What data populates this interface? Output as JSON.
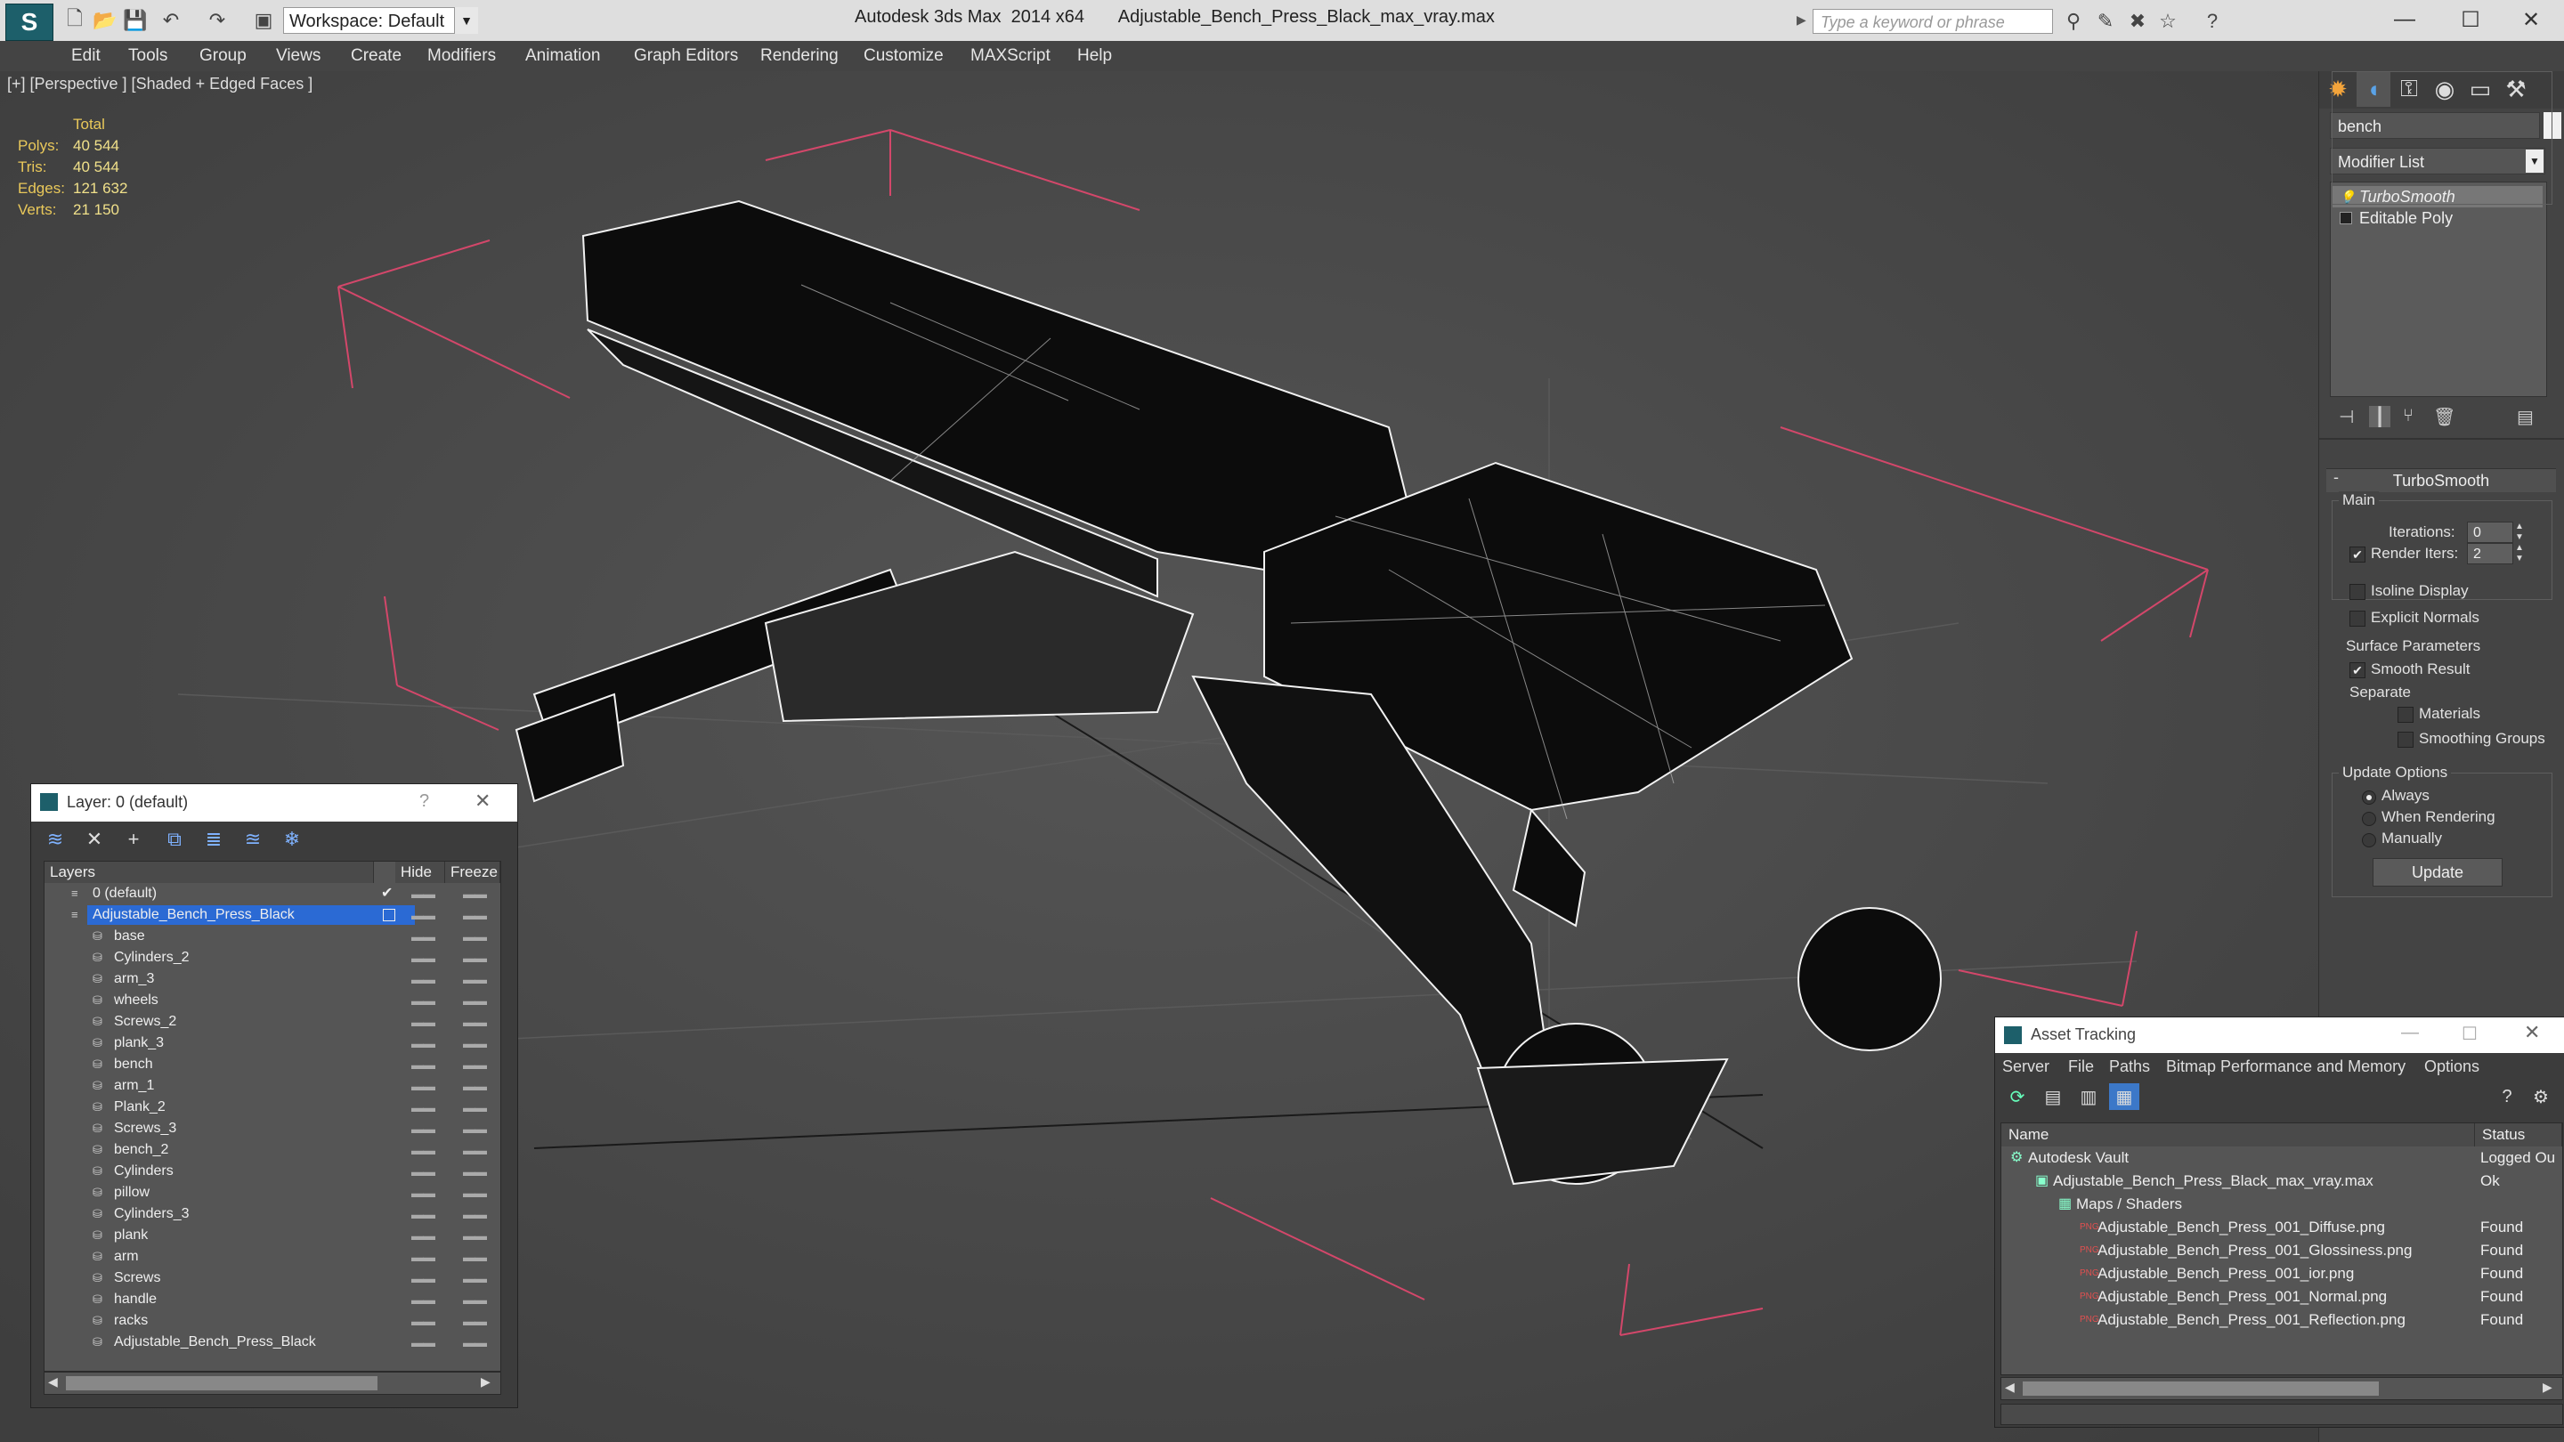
{
  "titlebar": {
    "workspace": "Workspace: Default",
    "title": "Autodesk 3ds Max  2014 x64       Adjustable_Bench_Press_Black_max_vray.max",
    "search_placeholder": "Type a keyword or phrase"
  },
  "menu": [
    "Edit",
    "Tools",
    "Group",
    "Views",
    "Create",
    "Modifiers",
    "Animation",
    "Graph Editors",
    "Rendering",
    "Customize",
    "MAXScript",
    "Help"
  ],
  "viewport": {
    "label": "[+] [Perspective ] [Shaded + Edged Faces ]",
    "stats": {
      "header": "Total",
      "rows": [
        {
          "label": "Polys:",
          "value": "40 544"
        },
        {
          "label": "Tris:",
          "value": "40 544"
        },
        {
          "label": "Edges:",
          "value": "121 632"
        },
        {
          "label": "Verts:",
          "value": "21 150"
        }
      ]
    }
  },
  "command_panel": {
    "object_name": "bench",
    "modifier_list": "Modifier List",
    "stack": [
      "TurboSmooth",
      "Editable Poly"
    ],
    "rollout_title": "TurboSmooth",
    "main_label": "Main",
    "iterations_label": "Iterations:",
    "iterations_value": "0",
    "render_iters_label": "Render Iters:",
    "render_iters_value": "2",
    "isoline_label": "Isoline Display",
    "explicit_normals_label": "Explicit Normals",
    "surface_params_label": "Surface Parameters",
    "smooth_result_label": "Smooth Result",
    "separate_label": "Separate",
    "materials_label": "Materials",
    "smoothing_groups_label": "Smoothing Groups",
    "update_options_label": "Update Options",
    "always_label": "Always",
    "when_rendering_label": "When Rendering",
    "manually_label": "Manually",
    "update_button": "Update"
  },
  "layer_dialog": {
    "title": "Layer: 0 (default)",
    "help": "?",
    "columns": [
      "Layers",
      "Hide",
      "Freeze"
    ],
    "rows": [
      {
        "name": "0 (default)",
        "level": 0
      },
      {
        "name": "Adjustable_Bench_Press_Black",
        "level": 0
      },
      {
        "name": "base",
        "level": 1
      },
      {
        "name": "Cylinders_2",
        "level": 1
      },
      {
        "name": "arm_3",
        "level": 1
      },
      {
        "name": "wheels",
        "level": 1
      },
      {
        "name": "Screws_2",
        "level": 1
      },
      {
        "name": "plank_3",
        "level": 1
      },
      {
        "name": "bench",
        "level": 1
      },
      {
        "name": "arm_1",
        "level": 1
      },
      {
        "name": "Plank_2",
        "level": 1
      },
      {
        "name": "Screws_3",
        "level": 1
      },
      {
        "name": "bench_2",
        "level": 1
      },
      {
        "name": "Cylinders",
        "level": 1
      },
      {
        "name": "pillow",
        "level": 1
      },
      {
        "name": "Cylinders_3",
        "level": 1
      },
      {
        "name": "plank",
        "level": 1
      },
      {
        "name": "arm",
        "level": 1
      },
      {
        "name": "Screws",
        "level": 1
      },
      {
        "name": "handle",
        "level": 1
      },
      {
        "name": "racks",
        "level": 1
      },
      {
        "name": "Adjustable_Bench_Press_Black",
        "level": 1
      }
    ]
  },
  "asset_dialog": {
    "title": "Asset Tracking",
    "menu": [
      "Server",
      "File",
      "Paths",
      "Bitmap Performance and Memory",
      "Options"
    ],
    "columns": [
      "Name",
      "Status"
    ],
    "rows": [
      {
        "name": "Autodesk Vault",
        "status": "Logged Ou"
      },
      {
        "name": "Adjustable_Bench_Press_Black_max_vray.max",
        "status": "Ok"
      },
      {
        "name": "Maps / Shaders",
        "status": ""
      },
      {
        "name": "Adjustable_Bench_Press_001_Diffuse.png",
        "status": "Found"
      },
      {
        "name": "Adjustable_Bench_Press_001_Glossiness.png",
        "status": "Found"
      },
      {
        "name": "Adjustable_Bench_Press_001_ior.png",
        "status": "Found"
      },
      {
        "name": "Adjustable_Bench_Press_001_Normal.png",
        "status": "Found"
      },
      {
        "name": "Adjustable_Bench_Press_001_Reflection.png",
        "status": "Found"
      }
    ]
  },
  "colors": {
    "accent": "#2b6ad4",
    "stats": "#e9c85a",
    "grid_box": "#d3476a"
  }
}
